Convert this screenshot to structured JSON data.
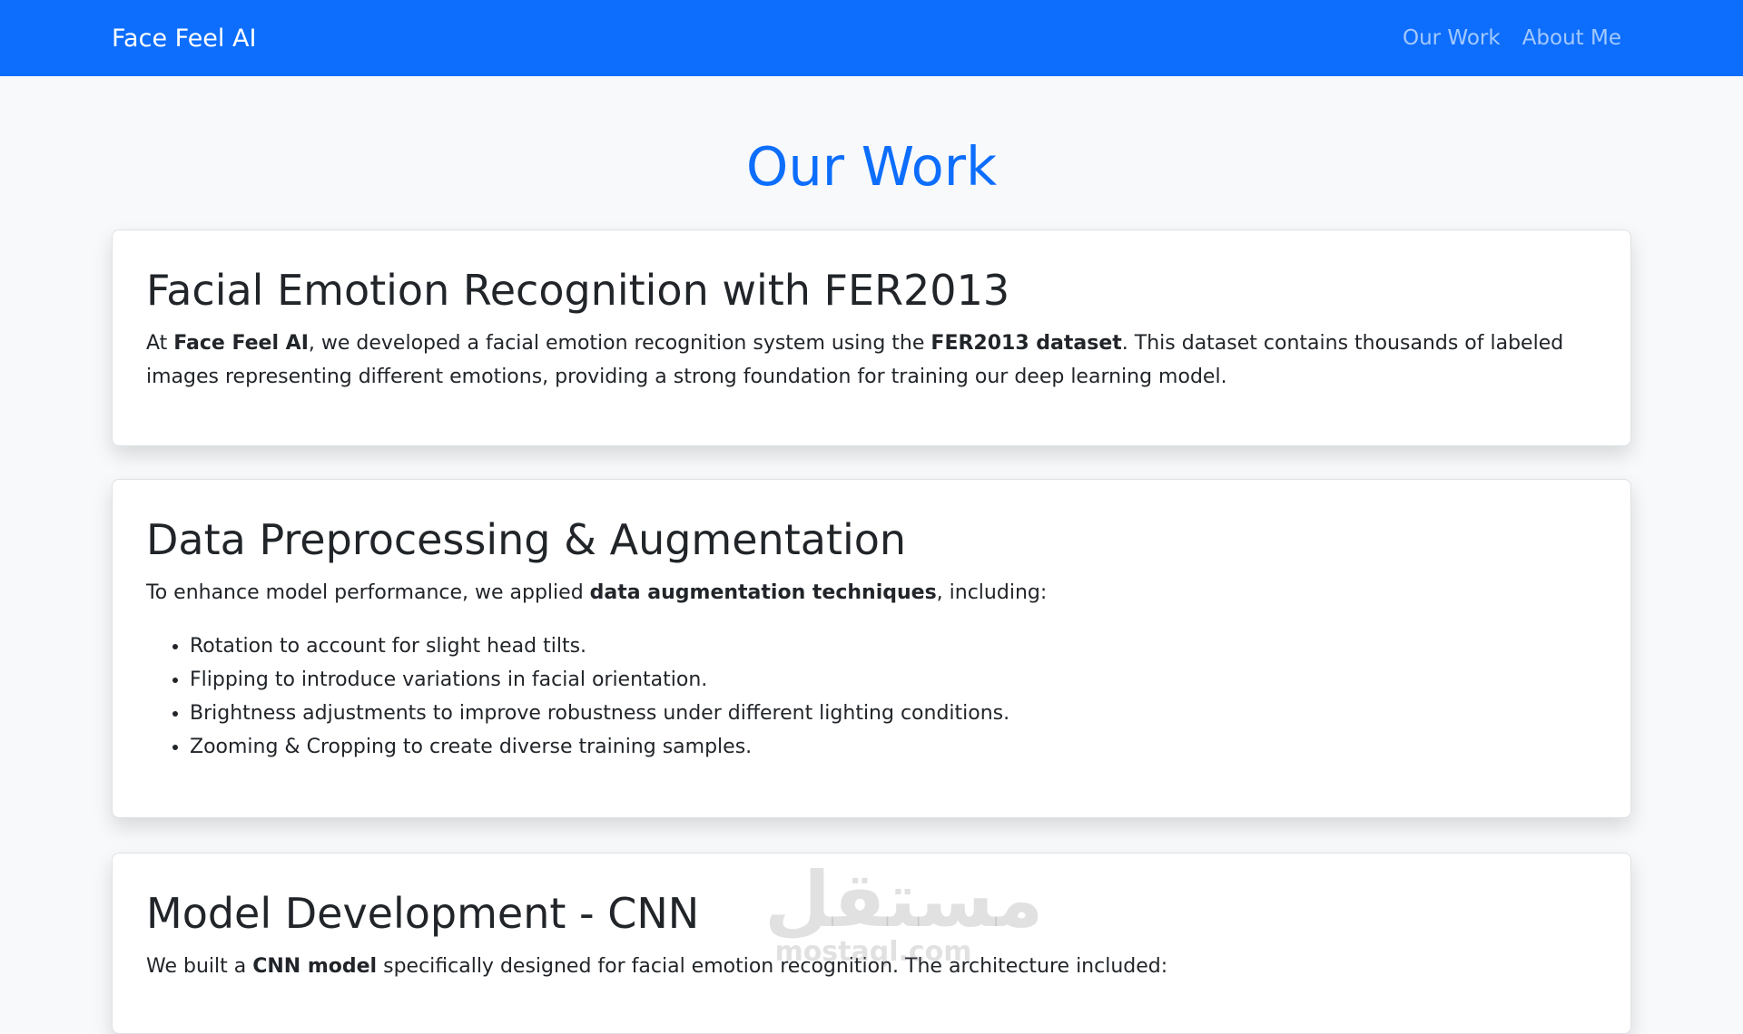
{
  "navbar": {
    "brand": "Face Feel AI",
    "links": [
      "Our Work",
      "About Me"
    ],
    "background": "#0d6efd"
  },
  "page": {
    "title": "Our Work",
    "title_color": "#0d6efd"
  },
  "cards": [
    {
      "title": "Facial Emotion Recognition with FER2013",
      "text_parts": [
        "At ",
        "Face Feel AI",
        ", we developed a facial emotion recognition system using the ",
        "FER2013 dataset",
        ". This dataset contains thousands of labeled images representing different emotions, providing a strong foundation for training our deep learning model."
      ]
    },
    {
      "title": "Data Preprocessing & Augmentation",
      "text_parts": [
        "To enhance model performance, we applied ",
        "data augmentation techniques",
        ", including:"
      ],
      "bullets": [
        "Rotation to account for slight head tilts.",
        "Flipping to introduce variations in facial orientation.",
        "Brightness adjustments to improve robustness under different lighting conditions.",
        "Zooming & Cropping to create diverse training samples."
      ]
    },
    {
      "title": "Model Development - CNN",
      "text_parts": [
        "We built a ",
        "CNN model",
        " specifically designed for facial emotion recognition. The architecture included:"
      ]
    }
  ],
  "watermark": {
    "arabic": "مستقل",
    "latin": "mostaql.com"
  }
}
